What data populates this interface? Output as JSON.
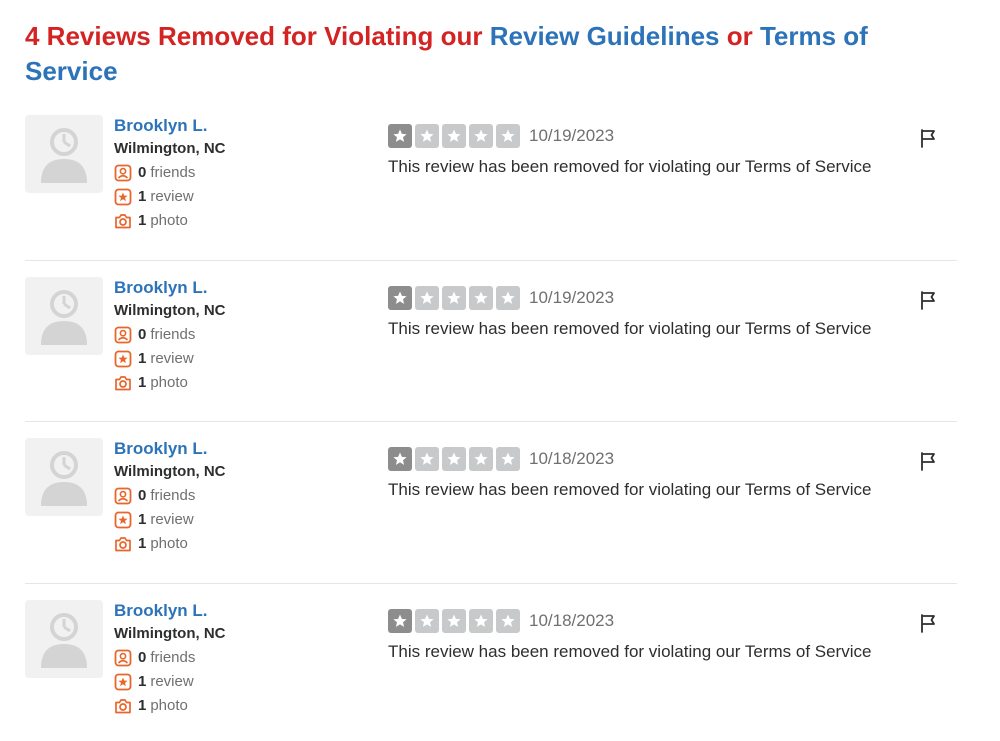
{
  "header": {
    "prefix": "4 Reviews Removed for Violating our ",
    "guidelines_link": "Review Guidelines",
    "or_text": " or ",
    "tos_link": "Terms of Service"
  },
  "colors": {
    "brand_red": "#d32323",
    "link_blue": "#2d73b9",
    "icon_orange": "#e8662c",
    "star_gray": "#8d8d8d"
  },
  "reviews": [
    {
      "user_name": "Brooklyn L.",
      "location": "Wilmington, NC",
      "friends_count": "0",
      "friends_label": "friends",
      "reviews_count": "1",
      "reviews_label": "review",
      "photos_count": "1",
      "photos_label": "photo",
      "rating": 1,
      "date": "10/19/2023",
      "text": "This review has been removed for violating our Terms of Service"
    },
    {
      "user_name": "Brooklyn L.",
      "location": "Wilmington, NC",
      "friends_count": "0",
      "friends_label": "friends",
      "reviews_count": "1",
      "reviews_label": "review",
      "photos_count": "1",
      "photos_label": "photo",
      "rating": 1,
      "date": "10/19/2023",
      "text": "This review has been removed for violating our Terms of Service"
    },
    {
      "user_name": "Brooklyn L.",
      "location": "Wilmington, NC",
      "friends_count": "0",
      "friends_label": "friends",
      "reviews_count": "1",
      "reviews_label": "review",
      "photos_count": "1",
      "photos_label": "photo",
      "rating": 1,
      "date": "10/18/2023",
      "text": "This review has been removed for violating our Terms of Service"
    },
    {
      "user_name": "Brooklyn L.",
      "location": "Wilmington, NC",
      "friends_count": "0",
      "friends_label": "friends",
      "reviews_count": "1",
      "reviews_label": "review",
      "photos_count": "1",
      "photos_label": "photo",
      "rating": 1,
      "date": "10/18/2023",
      "text": "This review has been removed for violating our Terms of Service"
    }
  ]
}
